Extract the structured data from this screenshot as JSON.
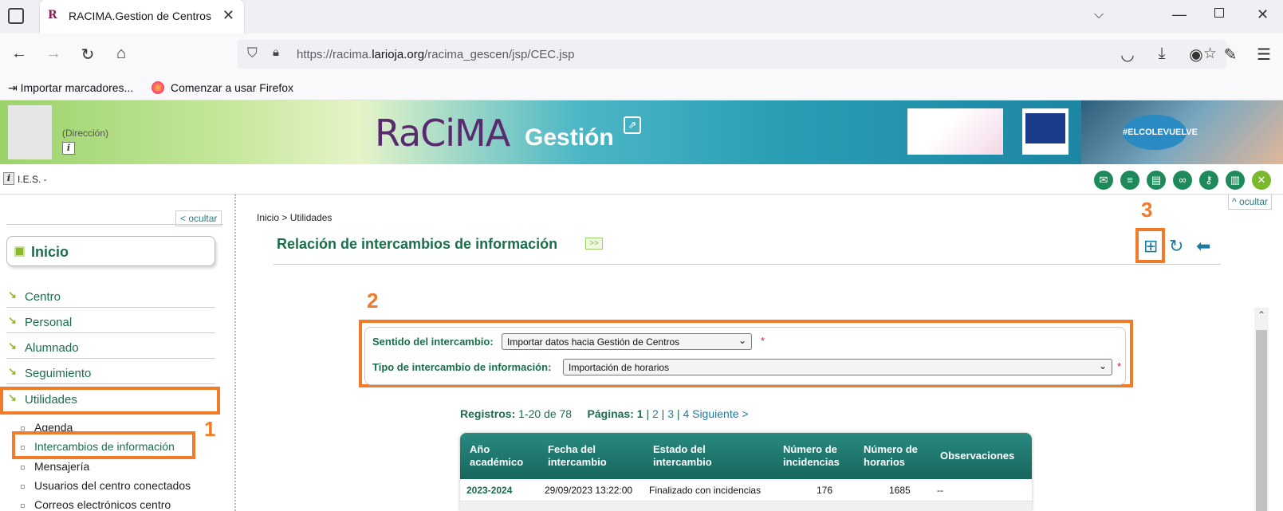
{
  "browser": {
    "tab_title": "RACIMA.Gestion de Centros",
    "url_prefix": "https://racima.",
    "url_domain": "larioja.org",
    "url_path": "/racima_gescen/jsp/CEC.jsp",
    "bookmarks": [
      "Importar marcadores...",
      "Comenzar a usar Firefox"
    ]
  },
  "header": {
    "direccion": "(Dirección)",
    "logo_text": "RaCiMA",
    "logo_sub": "Gestión",
    "campaign_badge": "#ELCOLEVUELVE",
    "school": "I.E.S. -"
  },
  "sidebar": {
    "hide_label": "< ocultar",
    "home_label": "Inicio",
    "items": [
      "Centro",
      "Personal",
      "Alumnado",
      "Seguimiento",
      "Utilidades"
    ],
    "sub_items": [
      "Agenda",
      "Intercambios de información",
      "Mensajería",
      "Usuarios del centro conectados",
      "Correos electrónicos centro"
    ]
  },
  "top_hide_label": "^ ocultar",
  "main": {
    "breadcrumb": "Inicio > Utilidades",
    "title": "Relación de intercambios de información",
    "expand_label": ">>",
    "filters": {
      "sentido_label": "Sentido del intercambio:",
      "sentido_value": "Importar datos hacia Gestión de Centros",
      "tipo_label": "Tipo de intercambio de información:",
      "tipo_value": "Importación de horarios",
      "required_mark": "*"
    },
    "registros_label": "Registros:",
    "registros_value": "1-20 de 78",
    "paginas_label": "Páginas:",
    "pages": [
      "1",
      "2",
      "3",
      "4 Siguiente >"
    ],
    "table": {
      "headers": [
        "Año académico",
        "Fecha del intercambio",
        "Estado del intercambio",
        "Número de incidencias",
        "Número de horarios",
        "Observaciones"
      ],
      "rows": [
        [
          "2023-2024",
          "29/09/2023 13:22:00",
          "Finalizado con incidencias",
          "176",
          "1685",
          "--"
        ]
      ]
    }
  },
  "annotations": [
    "1",
    "2",
    "3"
  ],
  "colors": {
    "accent": "#f07c2a",
    "brand_green": "#1a6e4a",
    "table_header": "#1e7a70"
  }
}
